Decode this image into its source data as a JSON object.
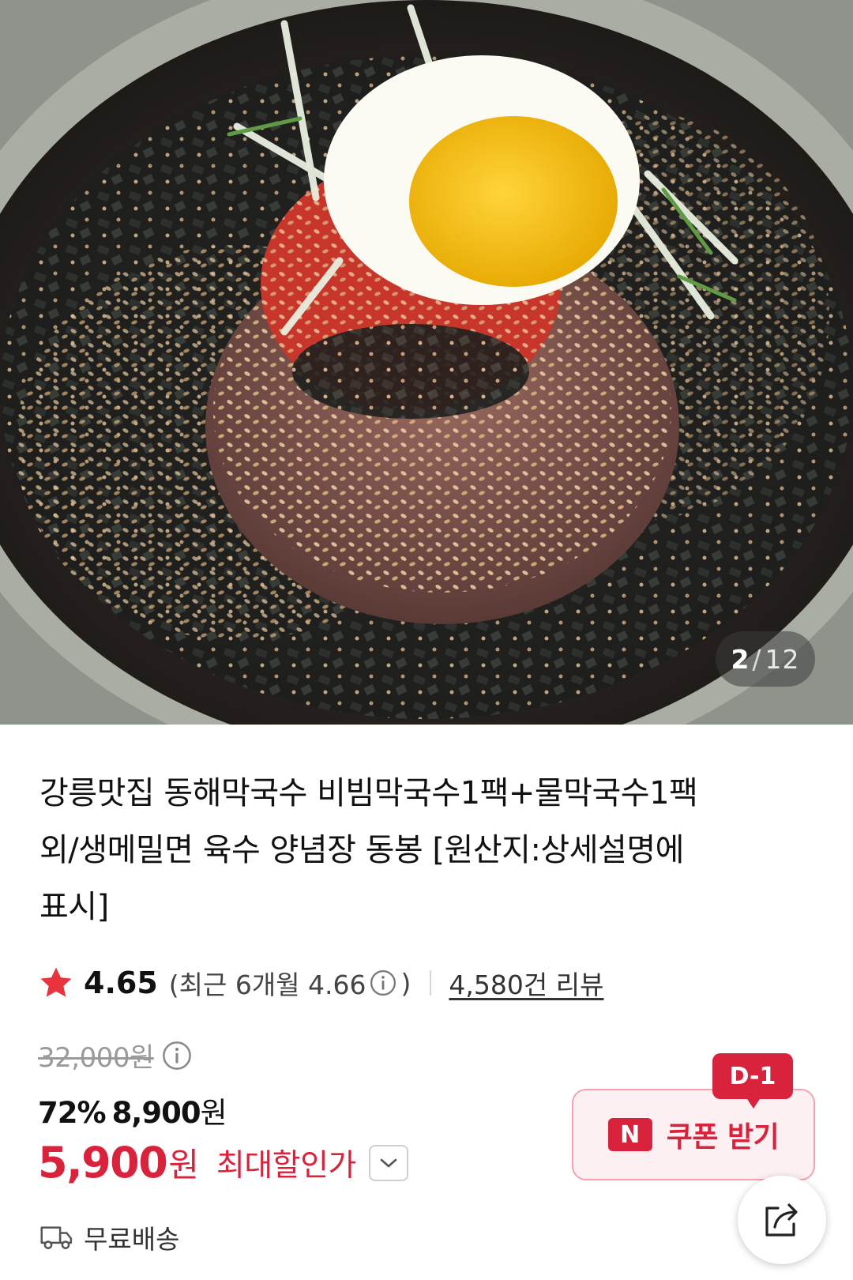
{
  "gallery": {
    "image_alt": "",
    "current_index": "2",
    "separator": "/",
    "total_count": "12"
  },
  "product": {
    "title_lines": [
      "강릉맛집 동해막국수 비빔막국수1팩+물막국수1팩",
      "외/생메밀면 육수 양념장 동봉 [원산지:상세설명에",
      "표시]"
    ]
  },
  "rating": {
    "score": "4.65",
    "recent_prefix": "(최근 6개월 4.66",
    "recent_suffix": ")",
    "review_link": "4,580건 리뷰"
  },
  "price": {
    "original": "32,000원",
    "discount_rate": "72%",
    "discount_price": "8,900",
    "discount_price_unit": "원",
    "final_price": "5,900",
    "final_unit": "원",
    "final_label": "최대할인가"
  },
  "shipping": {
    "label": "무료배송"
  },
  "coupon": {
    "badge": "N",
    "label": "쿠폰 받기",
    "dday": "D-1"
  },
  "icons": {
    "rating": "star-icon",
    "info": "info-icon",
    "expand": "chevron-down-icon",
    "shipping": "truck-icon",
    "share": "share-icon"
  },
  "colors": {
    "accent": "#d9233c",
    "star": "#e8343c",
    "coupon_bg": "#fdf0f2",
    "coupon_border": "#f2a3ae"
  }
}
